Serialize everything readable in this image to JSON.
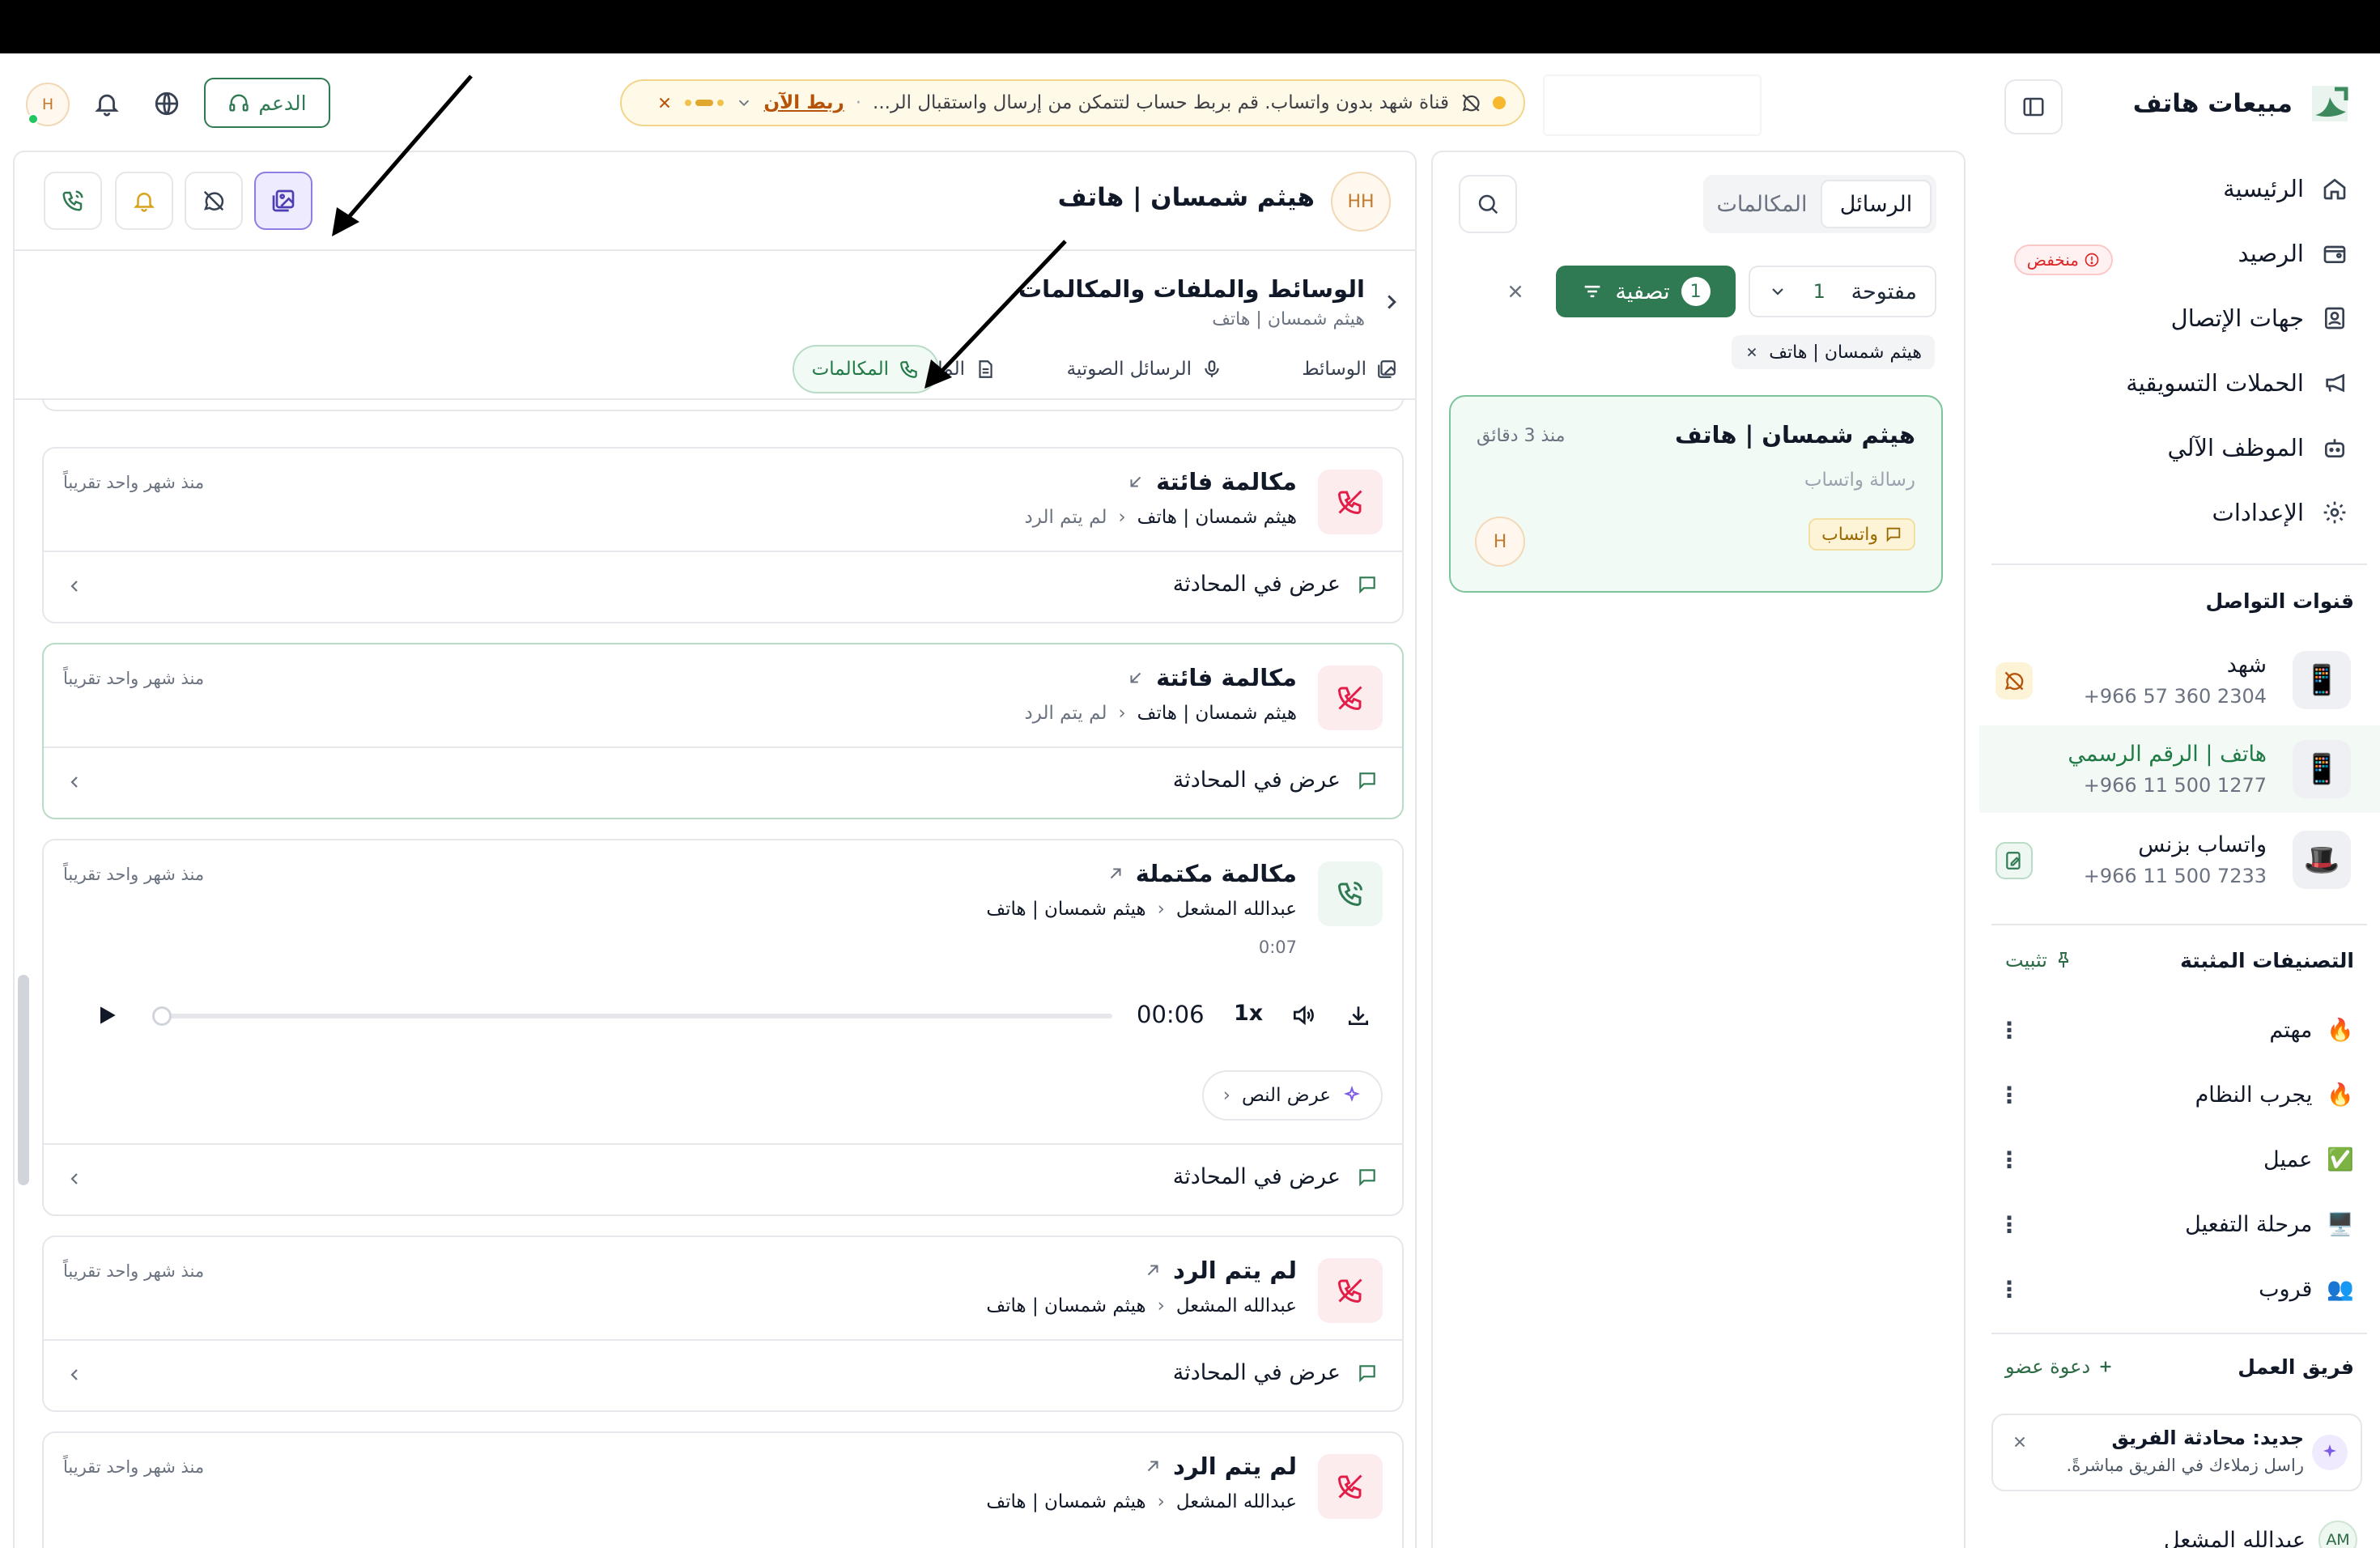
{
  "brand": {
    "name": "مبيعات هاتف"
  },
  "nav": [
    {
      "label": "الرئيسية",
      "icon": "home-icon"
    },
    {
      "label": "الرصيد",
      "icon": "wallet-icon",
      "badge": "منخفض"
    },
    {
      "label": "جهات الإتصال",
      "icon": "contacts-icon"
    },
    {
      "label": "الحملات التسويقية",
      "icon": "megaphone-icon"
    },
    {
      "label": "الموظف الآلي",
      "icon": "bot-icon"
    },
    {
      "label": "الإعدادات",
      "icon": "gear-icon"
    }
  ],
  "channels": {
    "title": "قنوات التواصل",
    "items": [
      {
        "name": "شهد",
        "number": "+966 57 360 2304",
        "icon": "📱"
      },
      {
        "name": "هاتف | الرقم الرسمي",
        "number": "+966 11 500 1277",
        "icon": "📱"
      },
      {
        "name": "واتساب بزنس",
        "number": "+966 11 500 7233",
        "icon": "🎩"
      }
    ]
  },
  "pinned": {
    "title": "التصنيفات المثبتة",
    "pin_label": "تثبيت",
    "items": [
      {
        "label": "مهتم",
        "emoji": "🔥"
      },
      {
        "label": "يجرب النظام",
        "emoji": "🔥"
      },
      {
        "label": "عميل",
        "emoji": "✅"
      },
      {
        "label": "مرحلة التفعيل",
        "emoji": "🖥️"
      },
      {
        "label": "قروب",
        "emoji": "👥"
      }
    ]
  },
  "team": {
    "title": "فريق العمل",
    "invite": "دعوة عضو",
    "card_title": "جديد: محادثة الفريق",
    "card_sub": "راسل زملاءك في الفريق مباشرةً.",
    "member": {
      "initials": "AM",
      "name": "عبدالله المشعل"
    }
  },
  "header": {
    "notice": "قناة شهد بدون واتساب. قم بربط حساب لتتمكن من إرسال واستقبال الر...",
    "notice_link": "ربط الآن",
    "support": "الدعم",
    "user_initial": "H"
  },
  "convs": {
    "tab_messages": "الرسائل",
    "tab_calls": "المكالمات",
    "status_filter": "مفتوحة",
    "status_count": "1",
    "filter_label": "تصفية",
    "filter_count": "1",
    "chip": "هيثم شمسان | هاتف",
    "card": {
      "name": "هيثم شمسان | هاتف",
      "time": "منذ 3 دقائق",
      "sub": "رسالة واتساب",
      "channel": "واتساب",
      "avatar": "H"
    }
  },
  "chat": {
    "avatar": "HH",
    "name": "هيثم شمسان | هاتف"
  },
  "media": {
    "title": "الوسائط والملفات والمكالمات",
    "subtitle": "هيثم شمسان | هاتف",
    "tabs": [
      "الوسائط",
      "الرسائل الصوتية",
      "الملفات",
      "المكالمات"
    ]
  },
  "calls": [
    {
      "title": "مكالمة فائتة",
      "from": "هيثم شمسان | هاتف",
      "to": "لم يتم الرد",
      "time": "منذ شهر واحد تقريباً",
      "foot": "عرض في المحادثة",
      "type": "missed"
    },
    {
      "title": "مكالمة فائتة",
      "from": "هيثم شمسان | هاتف",
      "to": "لم يتم الرد",
      "time": "منذ شهر واحد تقريباً",
      "foot": "عرض في المحادثة",
      "type": "missed"
    },
    {
      "title": "مكالمة مكتملة",
      "from": "عبدالله المشعل",
      "to": "هيثم شمسان | هاتف",
      "time": "منذ شهر واحد تقريباً",
      "foot": "عرض في المحادثة",
      "type": "completed",
      "duration": "0:07",
      "player_time": "00:06",
      "speed": "1x",
      "show_text": "عرض النص"
    },
    {
      "title": "لم يتم الرد",
      "from": "عبدالله المشعل",
      "to": "هيثم شمسان | هاتف",
      "time": "منذ شهر واحد تقريباً",
      "foot": "عرض في المحادثة",
      "type": "missed"
    },
    {
      "title": "لم يتم الرد",
      "from": "عبدالله المشعل",
      "to": "هيثم شمسان | هاتف",
      "time": "منذ شهر واحد تقريباً",
      "type": "missed"
    }
  ],
  "colors": {
    "accent": "#2f7a52",
    "missed": "#e11d48",
    "highlight": "#8b7fe6"
  }
}
